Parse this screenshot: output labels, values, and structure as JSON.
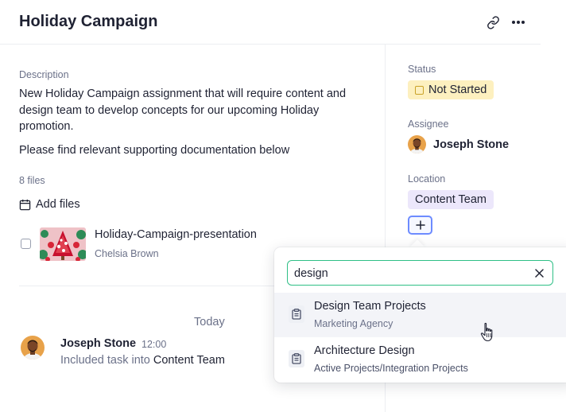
{
  "header": {
    "title": "Holiday Campaign",
    "icons": [
      "link-icon",
      "more-horizontal-icon"
    ]
  },
  "description": {
    "label": "Description",
    "text": "New Holiday Campaign assignment that will require content and design team to develop concepts for our upcoming Holiday promotion.",
    "text2": "Please find relevant supporting documentation below"
  },
  "files": {
    "count_label": "8 files",
    "add_label": "Add files",
    "items": [
      {
        "name": "Holiday-Campaign-presentation",
        "owner": "Chelsia Brown"
      }
    ]
  },
  "activity": {
    "day_label": "Today",
    "entries": [
      {
        "user": "Joseph Stone",
        "time": "12:00",
        "action": "Included task into",
        "target": "Content Team"
      }
    ]
  },
  "sidebar": {
    "status_label": "Status",
    "status_value": "Not Started",
    "assignee_label": "Assignee",
    "assignee_name": "Joseph Stone",
    "location_label": "Location",
    "location_value": "Content Team"
  },
  "dropdown": {
    "search_value": "design",
    "results": [
      {
        "title": "Design Team Projects",
        "subtitle": "Marketing Agency",
        "icon": "clipboard-icon"
      },
      {
        "title": "Architecture Design",
        "subtitle": "Active Projects/Integration Projects",
        "icon": "clipboard-icon"
      }
    ]
  },
  "colors": {
    "status_badge_bg": "#fdf0bf",
    "location_tag_bg": "#ece7fb",
    "search_focus": "#2fbf86",
    "accent_blue": "#6d8bff"
  }
}
